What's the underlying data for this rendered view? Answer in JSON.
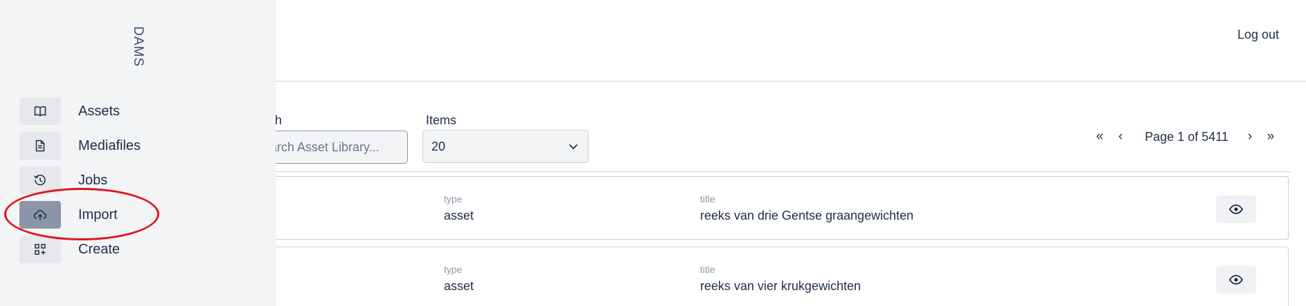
{
  "header": {
    "logout_label": "Log out"
  },
  "sidebar": {
    "brand": "DAMS",
    "items": [
      {
        "label": "Assets",
        "icon": "book-icon"
      },
      {
        "label": "Mediafiles",
        "icon": "document-icon"
      },
      {
        "label": "Jobs",
        "icon": "history-icon"
      },
      {
        "label": "Import",
        "icon": "cloud-upload-icon",
        "active": true
      },
      {
        "label": "Create",
        "icon": "grid-plus-icon"
      }
    ]
  },
  "filters": {
    "search_label": "ch",
    "search_placeholder": "arch Asset Library...",
    "items_label": "Items",
    "items_value": "20"
  },
  "pagination": {
    "first": "«",
    "prev": "‹",
    "page_text": "Page 1 of 5411",
    "next": "›",
    "last": "»"
  },
  "results": {
    "type_header": "type",
    "title_header": "title",
    "rows": [
      {
        "type": "asset",
        "title": "reeks van drie Gentse graangewichten"
      },
      {
        "type": "asset",
        "title": "reeks van vier krukgewichten"
      }
    ]
  },
  "colors": {
    "accent": "#1f2d45",
    "sidebar_bg": "#f3f4f6",
    "active_icon_bg": "#8a96a8",
    "highlight": "#e0141d"
  }
}
